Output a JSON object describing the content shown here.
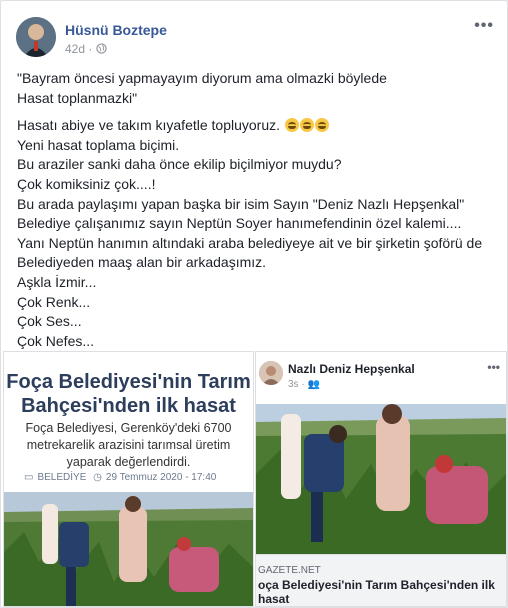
{
  "post": {
    "author": "Hüsnü Boztepe",
    "time": "42d",
    "privacy_icon": "globe-icon",
    "more_icon": "more-icon",
    "quote_lines": [
      "\"Bayram öncesi yapmayayım diyorum ama olmazki böylede",
      "Hasat toplanmazki\""
    ],
    "lines": [
      "Hasatı abiye ve takım kıyafetle topluyoruz.",
      "Yeni hasat toplama biçimi.",
      "Bu araziler sanki daha önce ekilip biçilmiyor muydu?",
      "Çok komiksiniz çok....!",
      "Bu arada paylaşımı yapan başka bir isim Sayın \"Deniz Nazlı Hepşenkal\"",
      "Belediye çalışanımız sayın Neptün Soyer hanımefendinin özel kalemi....",
      "Yanı Neptün hanımın altındaki araba belediyeye ait ve bir şirketin şoförü de",
      "Belediyeden maaş alan bir arkadaşımız.",
      "Aşkla İzmir...",
      "Çok Renk...",
      "Çok Ses...",
      "Çok Nefes..."
    ]
  },
  "media_left": {
    "title_line1": "Foça Belediyesi'nin Tarım",
    "title_line2": "Bahçesi'nden ilk hasat",
    "sub_line1": "Foça Belediyesi, Gerenköy'deki 6700",
    "sub_line2": "metrekarelik arazisini tarımsal üretim",
    "sub_line3": "yaparak değerlendirdi.",
    "category": "BELEDİYE",
    "date": "29 Temmuz 2020 - 17:40"
  },
  "media_right": {
    "author": "Nazlı Deniz Hepşenkal",
    "time": "3s",
    "domain": "GAZETE.NET",
    "headline": "oça Belediyesi'nin Tarım Bahçesi'nden ilk hasat"
  }
}
